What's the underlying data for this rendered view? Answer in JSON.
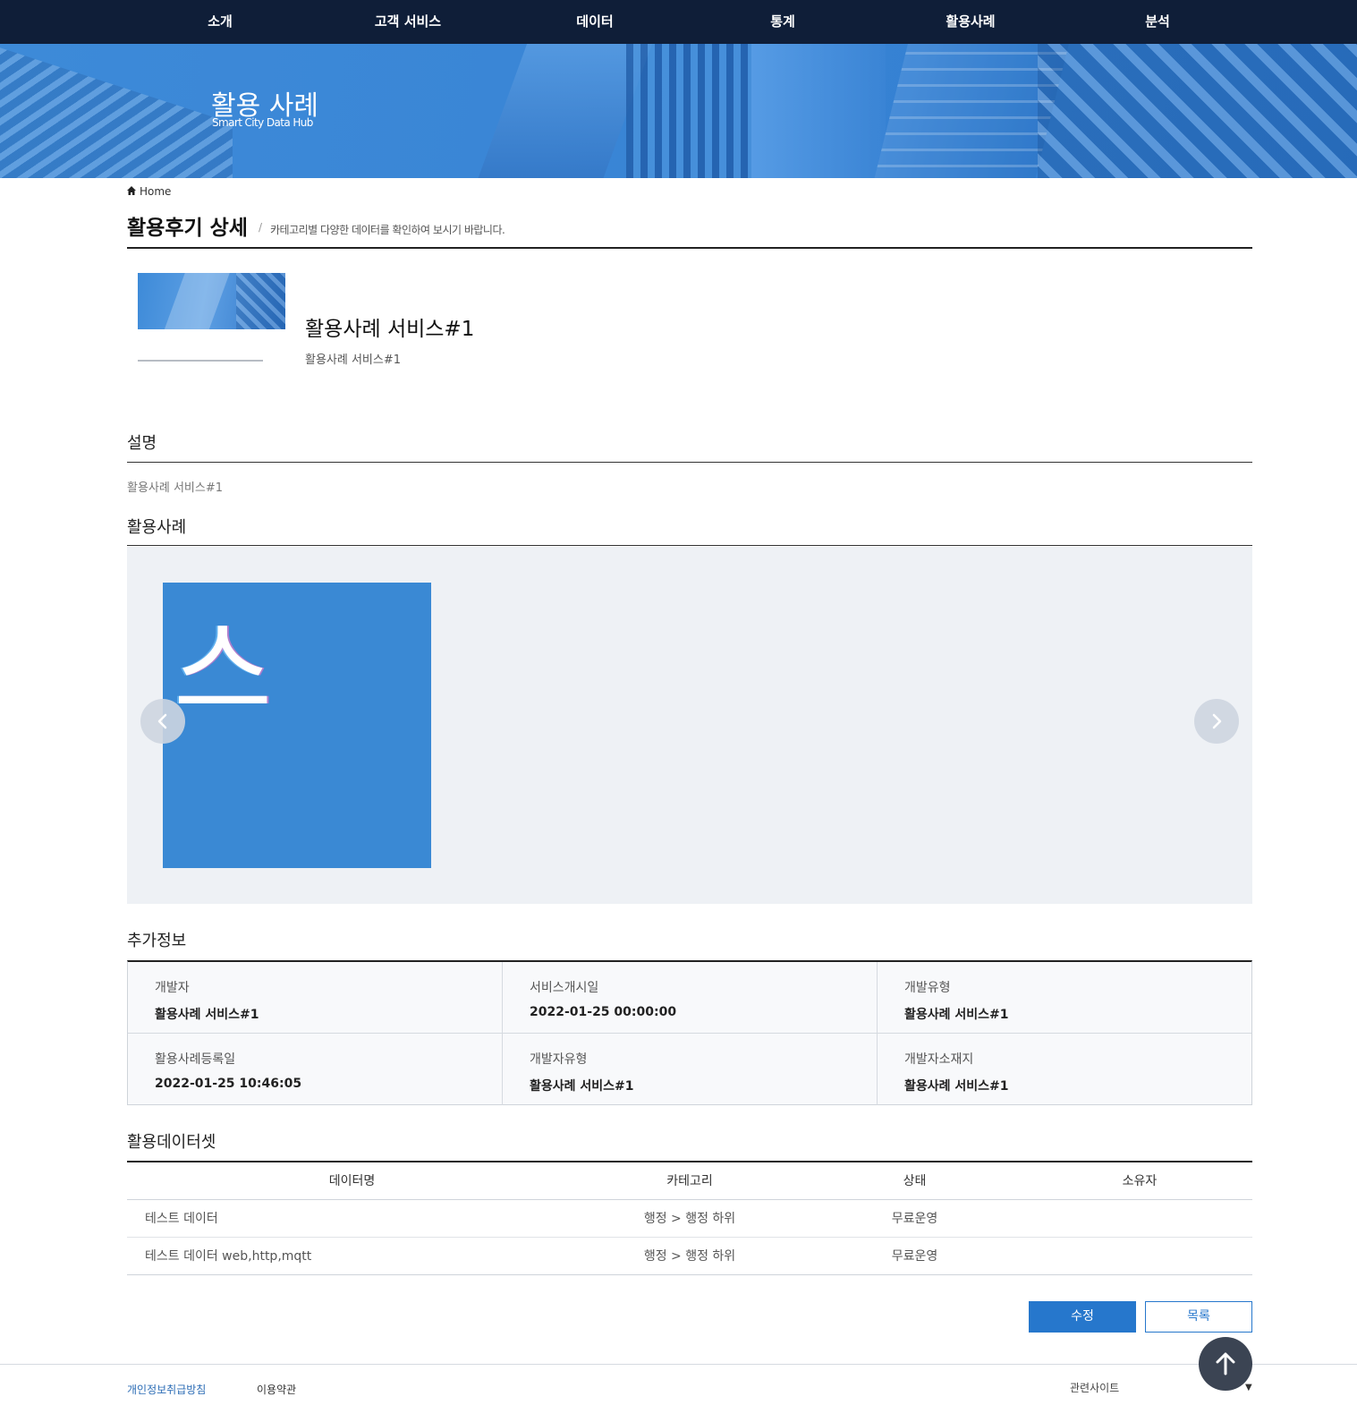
{
  "topnav": {
    "items": [
      "소개",
      "고객 서비스",
      "데이터",
      "통계",
      "활용사례",
      "분석"
    ]
  },
  "banner": {
    "title": "활용 사례",
    "subtitle": "Smart City Data Hub"
  },
  "breadcrumb": {
    "home_label": "Home",
    "icon": "home-icon"
  },
  "page": {
    "title": "활용후기 상세",
    "separator": "/",
    "description": "카테고리별 다양한 데이터를 확인하여 보시기 바랍니다."
  },
  "service": {
    "title": "활용사례 서비스#1",
    "subtitle": "활용사례 서비스#1"
  },
  "sections": {
    "description_title": "설명",
    "description_text": "활용사례 서비스#1",
    "cases_title": "활용사례",
    "extra_title": "추가정보",
    "datasets_title": "활용데이터셋"
  },
  "carousel": {
    "slide_glyph": "스",
    "prev_icon": "chevron-left-icon",
    "next_icon": "chevron-right-icon"
  },
  "extra_info": [
    {
      "label": "개발자",
      "value": "활용사례 서비스#1"
    },
    {
      "label": "서비스개시일",
      "value": "2022-01-25 00:00:00"
    },
    {
      "label": "개발유형",
      "value": "활용사례 서비스#1"
    },
    {
      "label": "활용사례등록일",
      "value": "2022-01-25 10:46:05"
    },
    {
      "label": "개발자유형",
      "value": "활용사례 서비스#1"
    },
    {
      "label": "개발자소재지",
      "value": "활용사례 서비스#1"
    }
  ],
  "datasets": {
    "columns": [
      "데이터명",
      "카테고리",
      "상태",
      "소유자"
    ],
    "rows": [
      {
        "name": "테스트 데이터",
        "category": "행정 > 행정 하위",
        "status": "무료운영",
        "owner": ""
      },
      {
        "name": "테스트 데이터 web,http,mqtt",
        "category": "행정 > 행정 하위",
        "status": "무료운영",
        "owner": ""
      }
    ]
  },
  "buttons": {
    "edit": "수정",
    "list": "목록"
  },
  "footer": {
    "privacy": "개인정보취급방침",
    "terms": "이용약관",
    "related_sites": "관련사이트",
    "related_caret": "▼",
    "top_icon": "arrow-up-icon"
  },
  "colors": {
    "nav_bg": "#0f1e38",
    "banner_blue": "#3a86d6",
    "primary": "#2677cc",
    "carousel_bg": "#eef1f5"
  }
}
